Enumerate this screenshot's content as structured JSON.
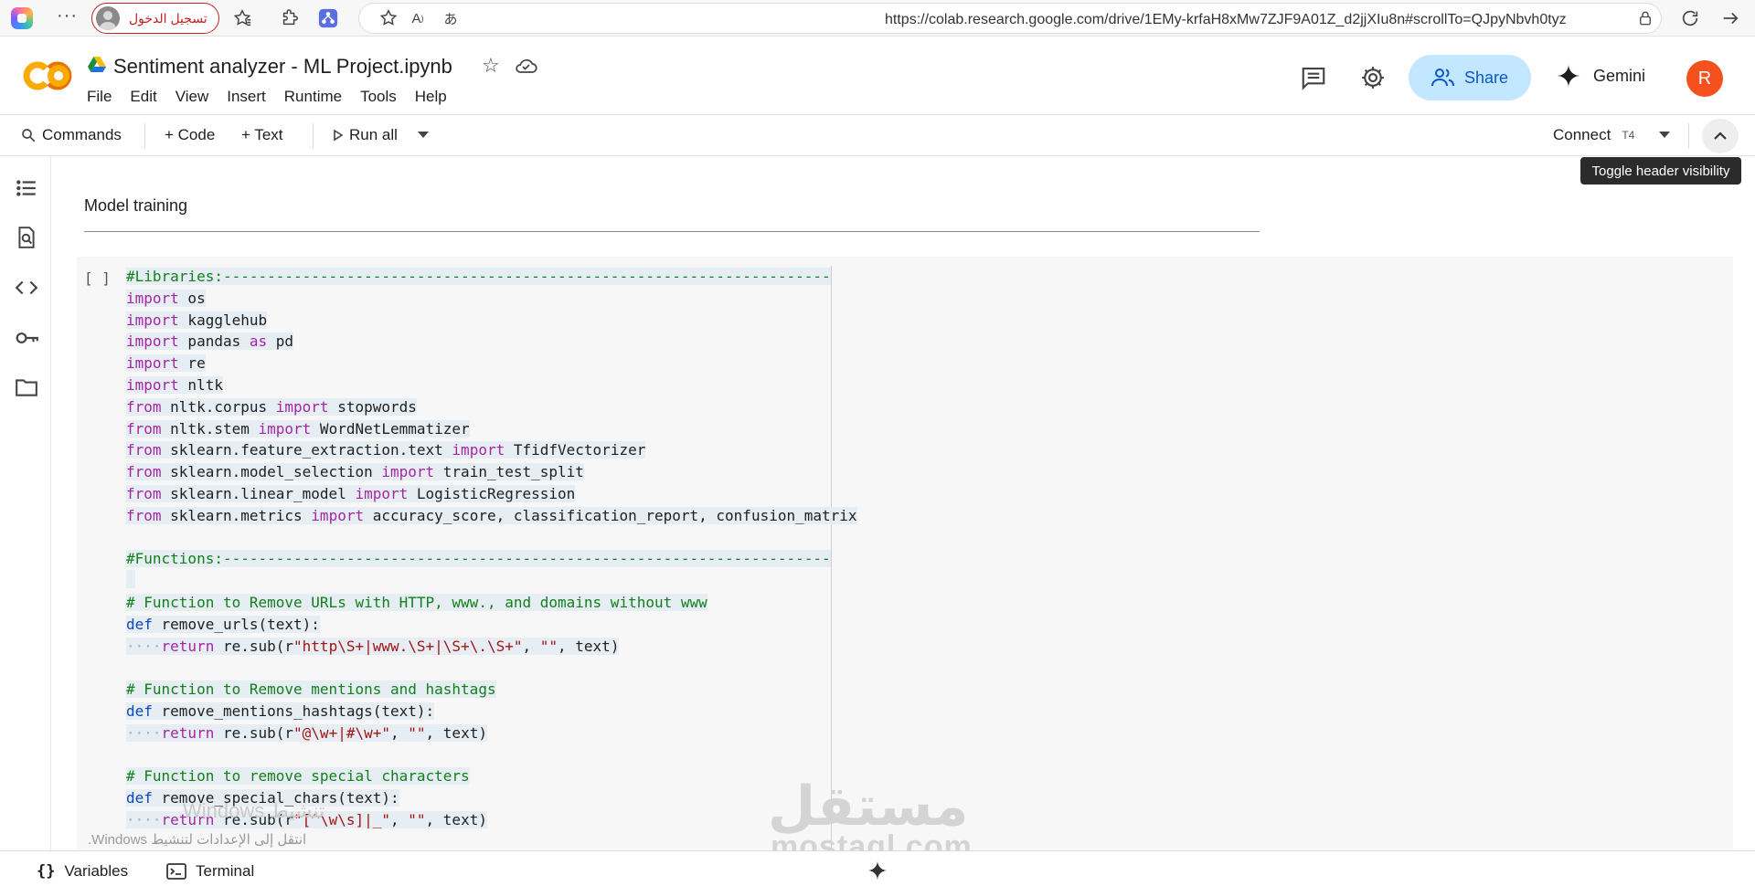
{
  "browser": {
    "signin_label": "تسجيل الدخول",
    "url": "https://colab.research.google.com/drive/1EMy-krfaH8xMw7ZJF9A01Z_d2jjXIu8n#scrollTo=QJpyNbvh0tyz",
    "more_label": "···"
  },
  "header": {
    "title": "Sentiment analyzer - ML Project.ipynb",
    "menu": [
      "File",
      "Edit",
      "View",
      "Insert",
      "Runtime",
      "Tools",
      "Help"
    ],
    "share_label": "Share",
    "gemini_label": "Gemini",
    "avatar_letter": "R"
  },
  "toolbar": {
    "commands_label": "Commands",
    "code_label": "+ Code",
    "text_label": "+ Text",
    "run_all_label": "Run all",
    "connect_label": "Connect",
    "runtime_type": "T4",
    "tooltip": "Toggle header visibility"
  },
  "notebook": {
    "section_title": "Model training",
    "cell_bracket": "[ ]"
  },
  "code_lines": [
    [
      [
        "cm",
        "#Libraries:---------------------------------------------------------------------"
      ]
    ],
    [
      [
        "kw",
        "import"
      ],
      [
        "tx",
        " os"
      ]
    ],
    [
      [
        "kw",
        "import"
      ],
      [
        "tx",
        " kagglehub"
      ]
    ],
    [
      [
        "kw",
        "import"
      ],
      [
        "tx",
        " pandas "
      ],
      [
        "kw",
        "as"
      ],
      [
        "tx",
        " pd"
      ]
    ],
    [
      [
        "kw",
        "import"
      ],
      [
        "tx",
        " re"
      ]
    ],
    [
      [
        "kw",
        "import"
      ],
      [
        "tx",
        " nltk"
      ]
    ],
    [
      [
        "kw",
        "from"
      ],
      [
        "tx",
        " nltk.corpus "
      ],
      [
        "kw",
        "import"
      ],
      [
        "tx",
        " stopwords"
      ]
    ],
    [
      [
        "kw",
        "from"
      ],
      [
        "tx",
        " nltk.stem "
      ],
      [
        "kw",
        "import"
      ],
      [
        "tx",
        " WordNetLemmatizer"
      ]
    ],
    [
      [
        "kw",
        "from"
      ],
      [
        "tx",
        " sklearn.feature_extraction.text "
      ],
      [
        "kw",
        "import"
      ],
      [
        "tx",
        " TfidfVectorizer"
      ]
    ],
    [
      [
        "kw",
        "from"
      ],
      [
        "tx",
        " sklearn.model_selection "
      ],
      [
        "kw",
        "import"
      ],
      [
        "tx",
        " train_test_split"
      ]
    ],
    [
      [
        "kw",
        "from"
      ],
      [
        "tx",
        " sklearn.linear_model "
      ],
      [
        "kw",
        "import"
      ],
      [
        "tx",
        " LogisticRegression"
      ]
    ],
    [
      [
        "kw",
        "from"
      ],
      [
        "tx",
        " sklearn.metrics "
      ],
      [
        "kw",
        "import"
      ],
      [
        "tx",
        " accuracy_score, classification_report, confusion_matrix"
      ]
    ],
    [],
    [
      [
        "cm",
        "#Functions:---------------------------------------------------------------------"
      ]
    ],
    [
      [
        "blank",
        ""
      ]
    ],
    [
      [
        "cm",
        "# Function to Remove URLs with HTTP, www., and domains without www"
      ]
    ],
    [
      [
        "df",
        "def"
      ],
      [
        "tx",
        " remove_urls(text):"
      ]
    ],
    [
      [
        "dt",
        "····"
      ],
      [
        "kw",
        "return"
      ],
      [
        "tx",
        " re.sub(r"
      ],
      [
        "st",
        "\"http\\S+|www.\\S+|\\S+\\.\\S+\""
      ],
      [
        "tx",
        ", "
      ],
      [
        "st",
        "\"\""
      ],
      [
        "tx",
        ", text)"
      ]
    ],
    [],
    [
      [
        "cm",
        "# Function to Remove mentions and hashtags"
      ]
    ],
    [
      [
        "df",
        "def"
      ],
      [
        "tx",
        " remove_mentions_hashtags(text):"
      ]
    ],
    [
      [
        "dt",
        "····"
      ],
      [
        "kw",
        "return"
      ],
      [
        "tx",
        " re.sub(r"
      ],
      [
        "st",
        "\"@\\w+|#\\w+\""
      ],
      [
        "tx",
        ", "
      ],
      [
        "st",
        "\"\""
      ],
      [
        "tx",
        ", text)"
      ]
    ],
    [],
    [
      [
        "cm",
        "# Function to remove special characters"
      ]
    ],
    [
      [
        "df",
        "def"
      ],
      [
        "tx",
        " remove_special_chars(text):"
      ]
    ],
    [
      [
        "dt",
        "····"
      ],
      [
        "kw",
        "return"
      ],
      [
        "tx",
        " re.sub(r"
      ],
      [
        "st",
        "\"[^\\w\\s]|_\""
      ],
      [
        "tx",
        ", "
      ],
      [
        "st",
        "\"\""
      ],
      [
        "tx",
        ", text)"
      ]
    ]
  ],
  "watermarks": {
    "windows_line1": "Windows تنشيط",
    "windows_line2": "انتقل إلى الإعدادات لتنشيط Windows.",
    "site_arabic": "مستقل",
    "site_latin": "mostaql.com"
  },
  "bottombar": {
    "variables_label": "Variables",
    "terminal_label": "Terminal"
  },
  "colors": {
    "share_bg": "#c2e7ff",
    "share_text": "#0b57d0",
    "avatar_bg": "#f4511e",
    "keyword": "#a626a4",
    "comment": "#12811c",
    "string": "#a31515",
    "def": "#0b47b8"
  }
}
